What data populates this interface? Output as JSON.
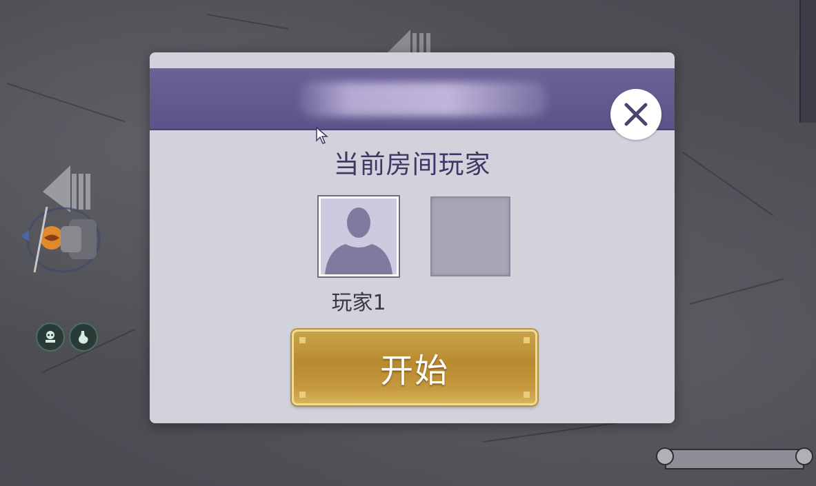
{
  "dialog": {
    "title": "当前房间玩家",
    "close_icon": "close-icon",
    "slots": [
      {
        "name": "玩家1",
        "occupied": true,
        "icon": "person-silhouette-icon"
      },
      {
        "name": "",
        "occupied": false
      }
    ],
    "start_label": "开始"
  },
  "hud": {
    "status_icons": [
      "skull-grave-icon",
      "stomach-icon"
    ]
  },
  "colors": {
    "header": "#5f5690",
    "dialog_bg": "#d2d2dc",
    "title_text": "#3d3866",
    "start_button": "#c29742"
  }
}
